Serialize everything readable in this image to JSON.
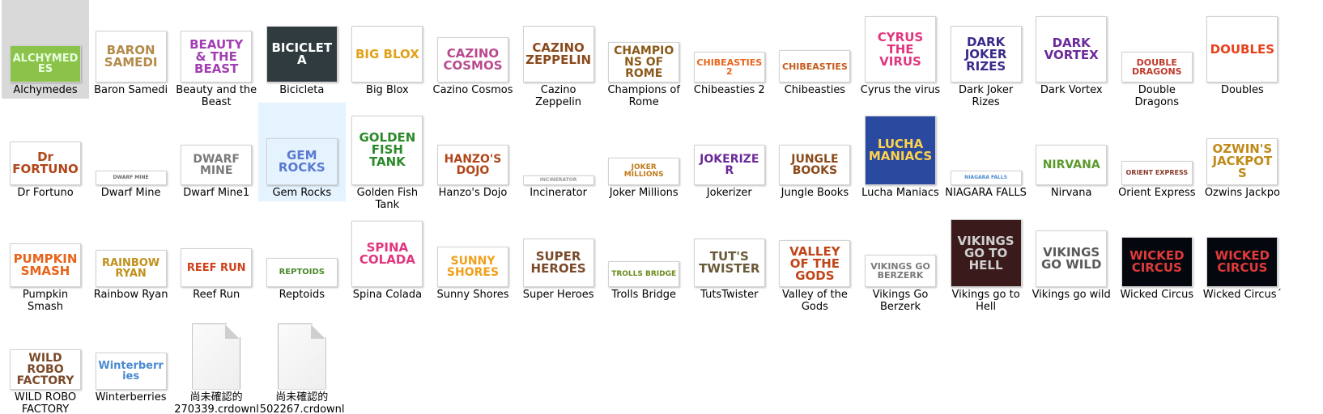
{
  "items": [
    {
      "id": "alchymedes",
      "label": "Alchymedes",
      "logo": "ALCHYMEDES",
      "bg": "#8bc34a",
      "fg": "#e8ffe0",
      "h": 46,
      "state": "selected"
    },
    {
      "id": "baron-samedi",
      "label": "Baron Samedi",
      "logo": "BARON SAMEDI",
      "bg": "#ffffff",
      "fg": "#b38b4a",
      "h": 64
    },
    {
      "id": "beauty-and-the-beast",
      "label": "Beauty and the Beast",
      "logo": "BEAUTY & THE BEAST",
      "bg": "#ffffff",
      "fg": "#a23fb3",
      "h": 64
    },
    {
      "id": "bicicleta",
      "label": "Bicicleta",
      "logo": "BICICLETA",
      "bg": "#2f3b3f",
      "fg": "#ffffff",
      "h": 70
    },
    {
      "id": "big-blox",
      "label": "Big Blox",
      "logo": "BIG BLOX",
      "bg": "#ffffff",
      "fg": "#e0a21a",
      "h": 70
    },
    {
      "id": "cazino-cosmos",
      "label": "Cazino Cosmos",
      "logo": "CAZINO COSMOS",
      "bg": "#ffffff",
      "fg": "#b84b8e",
      "h": 56
    },
    {
      "id": "cazino-zeppelin",
      "label": "Cazino Zeppelin",
      "logo": "CAZINO ZEPPELIN",
      "bg": "#ffffff",
      "fg": "#8b4a1c",
      "h": 70
    },
    {
      "id": "champions-of-rome",
      "label": "Champions of Rome",
      "logo": "CHAMPIONS OF ROME",
      "bg": "#ffffff",
      "fg": "#8b5a1a",
      "h": 50
    },
    {
      "id": "chibeasties-2",
      "label": "Chibeasties 2",
      "logo": "CHIBEASTIES 2",
      "bg": "#ffffff",
      "fg": "#e8641a",
      "h": 38
    },
    {
      "id": "chibeasties",
      "label": "Chibeasties",
      "logo": "CHIBEASTIES",
      "bg": "#ffffff",
      "fg": "#c55a1a",
      "h": 40
    },
    {
      "id": "cyrus-the-virus",
      "label": "Cyrus the virus",
      "logo": "CYRUS THE VIRUS",
      "bg": "#ffffff",
      "fg": "#e0367f",
      "h": 82
    },
    {
      "id": "dark-joker-rizes",
      "label": "Dark Joker Rizes",
      "logo": "DARK JOKER RIZES",
      "bg": "#ffffff",
      "fg": "#3b2a8a",
      "h": 70
    },
    {
      "id": "dark-vortex",
      "label": "Dark Vortex",
      "logo": "DARK VORTEX",
      "bg": "#ffffff",
      "fg": "#6a2a9a",
      "h": 82
    },
    {
      "id": "double-dragons",
      "label": "Double Dragons",
      "logo": "DOUBLE DRAGONS",
      "bg": "#ffffff",
      "fg": "#c03a2a",
      "h": 38
    },
    {
      "id": "doubles",
      "label": "Doubles",
      "logo": "DOUBLES",
      "bg": "#ffffff",
      "fg": "#e8401a",
      "h": 82
    },
    {
      "id": "dr-fortuno",
      "label": "Dr Fortuno",
      "logo": "Dr FORTUNO",
      "bg": "#ffffff",
      "fg": "#b0461a",
      "h": 54
    },
    {
      "id": "dwarf-mine",
      "label": "Dwarf Mine",
      "logo": "DWARF MINE",
      "bg": "#ffffff",
      "fg": "#6a6a6a",
      "h": 18
    },
    {
      "id": "dwarf-mine1",
      "label": "Dwarf Mine1",
      "logo": "DWARF MINE",
      "bg": "#ffffff",
      "fg": "#7a7a7a",
      "h": 50
    },
    {
      "id": "gem-rocks",
      "label": "Gem Rocks",
      "logo": "GEM ROCKS",
      "bg": "#e5f3ff",
      "fg": "#5a7ad0",
      "h": 58,
      "state": "hover"
    },
    {
      "id": "golden-fish-tank",
      "label": "Golden Fish Tank",
      "logo": "GOLDEN FISH TANK",
      "bg": "#ffffff",
      "fg": "#2a8a2a",
      "h": 86
    },
    {
      "id": "hanzos-dojo",
      "label": "Hanzo's Dojo",
      "logo": "HANZO'S DOJO",
      "bg": "#ffffff",
      "fg": "#b0461a",
      "h": 50
    },
    {
      "id": "incinerator",
      "label": "Incinerator",
      "logo": "INCINERATOR",
      "bg": "#ffffff",
      "fg": "#9a9a9a",
      "h": 12
    },
    {
      "id": "joker-millions",
      "label": "Joker Millions",
      "logo": "JOKER MILLIONS",
      "bg": "#ffffff",
      "fg": "#c07a1a",
      "h": 34
    },
    {
      "id": "jokerizer",
      "label": "Jokerizer",
      "logo": "JOKERIZER",
      "bg": "#ffffff",
      "fg": "#6a2a9a",
      "h": 50
    },
    {
      "id": "jungle-books",
      "label": "Jungle Books",
      "logo": "JUNGLE BOOKS",
      "bg": "#ffffff",
      "fg": "#8a4a1a",
      "h": 50
    },
    {
      "id": "lucha-maniacs",
      "label": "Lucha Maniacs",
      "logo": "LUCHA MANIACS",
      "bg": "#2a4aa0",
      "fg": "#ffd34a",
      "h": 86
    },
    {
      "id": "niagara-falls",
      "label": "NIAGARA FALLS",
      "logo": "NIAGARA FALLS",
      "bg": "#ffffff",
      "fg": "#4a8ad0",
      "h": 18
    },
    {
      "id": "nirvana",
      "label": "Nirvana",
      "logo": "NIRVANA",
      "bg": "#ffffff",
      "fg": "#5a9a2a",
      "h": 50
    },
    {
      "id": "orient-express",
      "label": "Orient Express",
      "logo": "ORIENT EXPRESS",
      "bg": "#ffffff",
      "fg": "#8a3a2a",
      "h": 30
    },
    {
      "id": "ozwins-jackpots",
      "label": "Ozwins Jackpo",
      "logo": "OZWIN'S JACKPOTS",
      "bg": "#ffffff",
      "fg": "#c08a1a",
      "h": 58
    },
    {
      "id": "pumpkin-smash",
      "label": "Pumpkin Smash",
      "logo": "PUMPKIN SMASH",
      "bg": "#ffffff",
      "fg": "#e8641a",
      "h": 54
    },
    {
      "id": "rainbow-ryan",
      "label": "Rainbow Ryan",
      "logo": "RAINBOW RYAN",
      "bg": "#ffffff",
      "fg": "#c0901a",
      "h": 46
    },
    {
      "id": "reef-run",
      "label": "Reef Run",
      "logo": "REEF RUN",
      "bg": "#ffffff",
      "fg": "#d0401a",
      "h": 48
    },
    {
      "id": "reptoids",
      "label": "Reptoids",
      "logo": "REPTOIDS",
      "bg": "#ffffff",
      "fg": "#4a8a2a",
      "h": 36
    },
    {
      "id": "spina-colada",
      "label": "Spina Colada",
      "logo": "SPINA COLADA",
      "bg": "#ffffff",
      "fg": "#e0367f",
      "h": 82
    },
    {
      "id": "sunny-shores",
      "label": "Sunny Shores",
      "logo": "SUNNY SHORES",
      "bg": "#ffffff",
      "fg": "#f0a01a",
      "h": 50
    },
    {
      "id": "super-heroes",
      "label": "Super Heroes",
      "logo": "SUPER HEROES",
      "bg": "#ffffff",
      "fg": "#7a4a2a",
      "h": 60
    },
    {
      "id": "trolls-bridge",
      "label": "Trolls Bridge",
      "logo": "TROLLS BRIDGE",
      "bg": "#ffffff",
      "fg": "#6a8a1a",
      "h": 32
    },
    {
      "id": "tutstwister",
      "label": "TutsTwister",
      "logo": "TUT'S TWISTER",
      "bg": "#ffffff",
      "fg": "#6a5a3a",
      "h": 60
    },
    {
      "id": "valley-of-the-gods",
      "label": "Valley of the Gods",
      "logo": "VALLEY OF THE GODS",
      "bg": "#ffffff",
      "fg": "#c0461a",
      "h": 58
    },
    {
      "id": "vikings-go-berzerk",
      "label": "Vikings Go Berzerk",
      "logo": "VIKINGS GO BERZERK",
      "bg": "#ffffff",
      "fg": "#7a7a7a",
      "h": 40
    },
    {
      "id": "vikings-go-to-hell",
      "label": "Vikings go to Hell",
      "logo": "VIKINGS GO TO HELL",
      "bg": "#3a1a1a",
      "fg": "#d0d0d0",
      "h": 84
    },
    {
      "id": "vikings-go-wild",
      "label": "Vikings go wild",
      "logo": "VIKINGS GO WILD",
      "bg": "#ffffff",
      "fg": "#5a5a5a",
      "h": 70
    },
    {
      "id": "wicked-circus",
      "label": "Wicked Circus",
      "logo": "WICKED CIRCUS",
      "bg": "#05070f",
      "fg": "#e03a3a",
      "h": 62
    },
    {
      "id": "wicked-circus-2",
      "label": "Wicked Circus´",
      "logo": "WICKED CIRCUS",
      "bg": "#05070f",
      "fg": "#e03a3a",
      "h": 62
    },
    {
      "id": "wild-robo-factory",
      "label": "WILD ROBO FACTORY",
      "logo": "WILD ROBO FACTORY",
      "bg": "#ffffff",
      "fg": "#7a4a2a",
      "h": 50
    },
    {
      "id": "winterberries",
      "label": "Winterberries",
      "logo": "Winterberries",
      "bg": "#ffffff",
      "fg": "#4a8ad0",
      "h": 46
    },
    {
      "id": "file-1",
      "label": "尚未確認的 270339.crdownl",
      "type": "file"
    },
    {
      "id": "file-2",
      "label": "尚未確認的 502267.crdownl",
      "type": "file"
    }
  ]
}
